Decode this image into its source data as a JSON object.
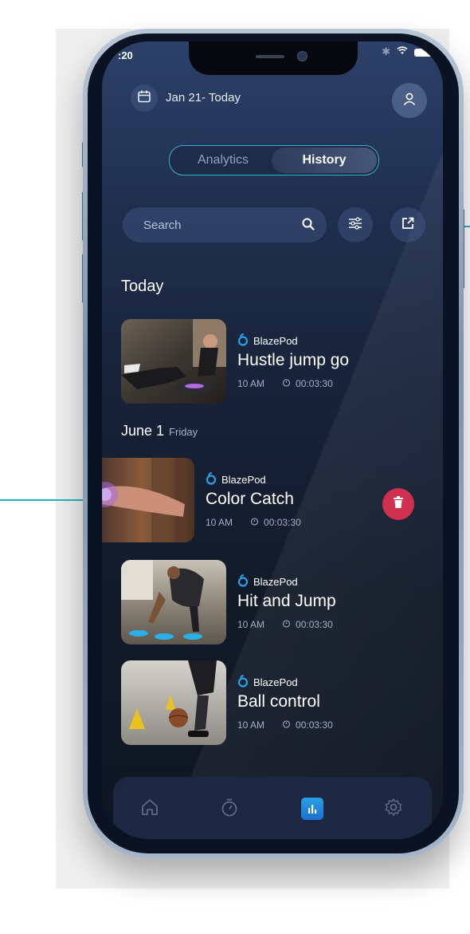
{
  "status_bar": {
    "time": ":20"
  },
  "header": {
    "date_range": "Jan 21- Today"
  },
  "segmented_control": {
    "tabs": [
      "Analytics",
      "History"
    ],
    "active": "History"
  },
  "search": {
    "placeholder": "Search"
  },
  "sections": {
    "today": {
      "title": "Today"
    },
    "june": {
      "title": "June 1",
      "day": "Friday"
    }
  },
  "sessions": [
    {
      "brand": "BlazePod",
      "title": "Hustle jump go",
      "time": "10 AM",
      "duration": "00:03:30"
    },
    {
      "brand": "BlazePod",
      "title": "Color Catch",
      "time": "10 AM",
      "duration": "00:03:30"
    },
    {
      "brand": "BlazePod",
      "title": "Hit and Jump",
      "time": "10 AM",
      "duration": "00:03:30"
    },
    {
      "brand": "BlazePod",
      "title": "Ball control",
      "time": "10 AM",
      "duration": "00:03:30"
    }
  ],
  "tab_bar": {
    "items": [
      {
        "icon": "home-icon"
      },
      {
        "icon": "timer-icon"
      },
      {
        "icon": "stats-icon",
        "active": true
      },
      {
        "icon": "gear-icon"
      }
    ]
  },
  "colors": {
    "accent": "#2fb6c8",
    "callout": "#1fb3c4",
    "delete": "#d0304f",
    "active_tab": "#2aa0e6"
  }
}
